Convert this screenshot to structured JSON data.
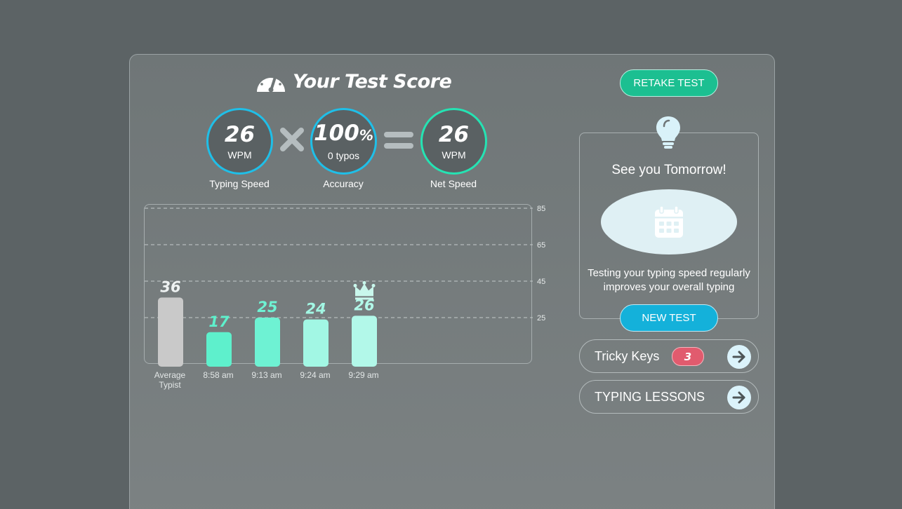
{
  "header": {
    "title": "Your Test Score"
  },
  "scores": {
    "typing_speed": {
      "value": "26",
      "unit": "WPM",
      "caption": "Typing Speed"
    },
    "accuracy": {
      "value": "100",
      "suffix": "%",
      "sub": "0 typos",
      "caption": "Accuracy"
    },
    "net_speed": {
      "value": "26",
      "unit": "WPM",
      "caption": "Net Speed"
    }
  },
  "buttons": {
    "retake": "RETAKE TEST",
    "new_test": "NEW TEST"
  },
  "tip": {
    "title": "See you Tomorrow!",
    "text_line1": "Testing your typing speed regularly",
    "text_line2": "improves your overall typing"
  },
  "tricky_keys": {
    "label": "Tricky Keys",
    "count": "3"
  },
  "typing_lessons": {
    "label": "TYPING LESSONS"
  },
  "colors": {
    "accent_blue": "#1fbfe8",
    "accent_green": "#25e3b3",
    "retake_green": "#1cbf91",
    "new_test_blue": "#14b1da",
    "badge_red": "#e15b6e"
  },
  "chart_data": {
    "type": "bar",
    "categories": [
      "Average Typist",
      "8:58 am",
      "9:13 am",
      "9:24 am",
      "9:29 am"
    ],
    "category_lines": [
      [
        "Average",
        "Typist"
      ],
      [
        "8:58 am"
      ],
      [
        "9:13 am"
      ],
      [
        "9:24 am"
      ],
      [
        "9:29 am"
      ]
    ],
    "values": [
      36,
      17,
      25,
      24,
      26
    ],
    "value_labels": [
      "36",
      "17",
      "25",
      "24",
      "26"
    ],
    "bar_colors": [
      "#c9c9c9",
      "#5ef0cc",
      "#6ef2d3",
      "#a2f7e4",
      "#b2f8e9"
    ],
    "best_index": 4,
    "yticks": [
      25,
      45,
      65,
      85
    ],
    "ytick_labels": [
      "25",
      "45",
      "65",
      "85"
    ],
    "ylim": [
      0,
      85
    ],
    "grid": true,
    "gridline_style": "dashed"
  }
}
